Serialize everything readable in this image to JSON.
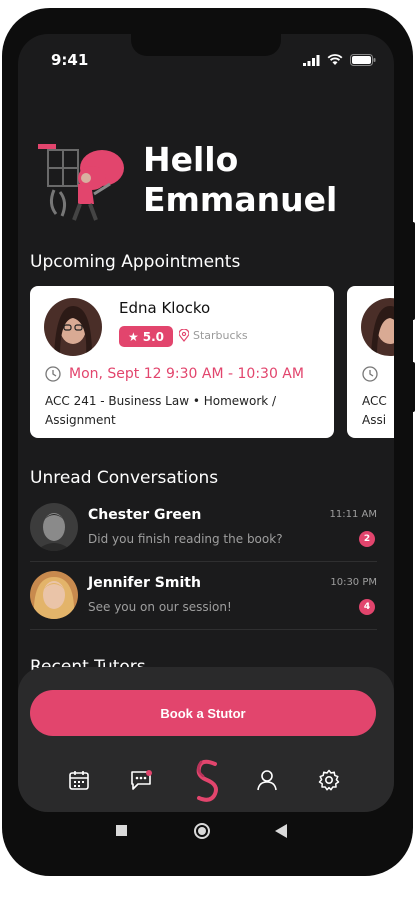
{
  "status": {
    "time": "9:41"
  },
  "greeting": {
    "line1": "Hello",
    "line2": "Emmanuel"
  },
  "appointments": {
    "title": "Upcoming Appointments",
    "items": [
      {
        "tutor": "Edna Klocko",
        "rating": "5.0",
        "location": "Starbucks",
        "time": "Mon,  Sept 12 9:30 AM - 10:30 AM",
        "description": "ACC 241 - Business Law • Homework / Assignment"
      },
      {
        "tutor": "",
        "rating": "",
        "location": "",
        "time": "",
        "description": "ACC Assi"
      }
    ]
  },
  "conversations": {
    "title": "Unread Conversations",
    "items": [
      {
        "name": "Chester Green",
        "message": "Did you finish reading the book?",
        "time": "11:11 AM",
        "unread": "2"
      },
      {
        "name": "Jennifer Smith",
        "message": "See you on our session!",
        "time": "10:30 PM",
        "unread": "4"
      }
    ]
  },
  "recent_tutors": {
    "title": "Recent Tutors"
  },
  "book_button": {
    "label": "Book a Stutor"
  },
  "nav": {
    "items": [
      {
        "icon": "calendar-icon"
      },
      {
        "icon": "chat-icon"
      },
      {
        "icon": "stutor-logo-icon"
      },
      {
        "icon": "profile-icon"
      },
      {
        "icon": "settings-icon"
      }
    ]
  },
  "colors": {
    "accent": "#e2456d",
    "background": "#1b1b1c",
    "card": "#ffffff"
  }
}
